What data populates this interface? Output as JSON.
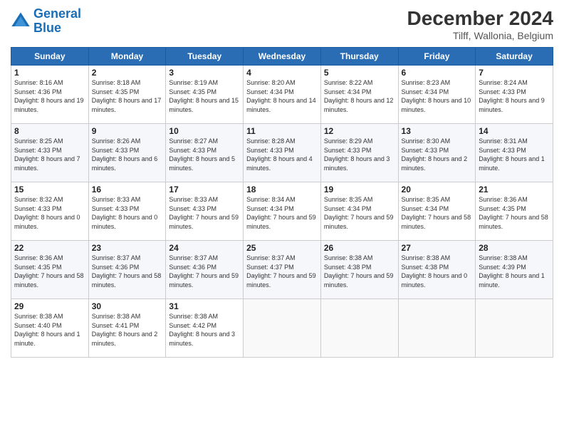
{
  "logo": {
    "line1": "General",
    "line2": "Blue"
  },
  "title": "December 2024",
  "subtitle": "Tilff, Wallonia, Belgium",
  "weekdays": [
    "Sunday",
    "Monday",
    "Tuesday",
    "Wednesday",
    "Thursday",
    "Friday",
    "Saturday"
  ],
  "weeks": [
    [
      {
        "day": "1",
        "sunrise": "8:16 AM",
        "sunset": "4:36 PM",
        "daylight": "8 hours and 19 minutes."
      },
      {
        "day": "2",
        "sunrise": "8:18 AM",
        "sunset": "4:35 PM",
        "daylight": "8 hours and 17 minutes."
      },
      {
        "day": "3",
        "sunrise": "8:19 AM",
        "sunset": "4:35 PM",
        "daylight": "8 hours and 15 minutes."
      },
      {
        "day": "4",
        "sunrise": "8:20 AM",
        "sunset": "4:34 PM",
        "daylight": "8 hours and 14 minutes."
      },
      {
        "day": "5",
        "sunrise": "8:22 AM",
        "sunset": "4:34 PM",
        "daylight": "8 hours and 12 minutes."
      },
      {
        "day": "6",
        "sunrise": "8:23 AM",
        "sunset": "4:34 PM",
        "daylight": "8 hours and 10 minutes."
      },
      {
        "day": "7",
        "sunrise": "8:24 AM",
        "sunset": "4:33 PM",
        "daylight": "8 hours and 9 minutes."
      }
    ],
    [
      {
        "day": "8",
        "sunrise": "8:25 AM",
        "sunset": "4:33 PM",
        "daylight": "8 hours and 7 minutes."
      },
      {
        "day": "9",
        "sunrise": "8:26 AM",
        "sunset": "4:33 PM",
        "daylight": "8 hours and 6 minutes."
      },
      {
        "day": "10",
        "sunrise": "8:27 AM",
        "sunset": "4:33 PM",
        "daylight": "8 hours and 5 minutes."
      },
      {
        "day": "11",
        "sunrise": "8:28 AM",
        "sunset": "4:33 PM",
        "daylight": "8 hours and 4 minutes."
      },
      {
        "day": "12",
        "sunrise": "8:29 AM",
        "sunset": "4:33 PM",
        "daylight": "8 hours and 3 minutes."
      },
      {
        "day": "13",
        "sunrise": "8:30 AM",
        "sunset": "4:33 PM",
        "daylight": "8 hours and 2 minutes."
      },
      {
        "day": "14",
        "sunrise": "8:31 AM",
        "sunset": "4:33 PM",
        "daylight": "8 hours and 1 minute."
      }
    ],
    [
      {
        "day": "15",
        "sunrise": "8:32 AM",
        "sunset": "4:33 PM",
        "daylight": "8 hours and 0 minutes."
      },
      {
        "day": "16",
        "sunrise": "8:33 AM",
        "sunset": "4:33 PM",
        "daylight": "8 hours and 0 minutes."
      },
      {
        "day": "17",
        "sunrise": "8:33 AM",
        "sunset": "4:33 PM",
        "daylight": "7 hours and 59 minutes."
      },
      {
        "day": "18",
        "sunrise": "8:34 AM",
        "sunset": "4:34 PM",
        "daylight": "7 hours and 59 minutes."
      },
      {
        "day": "19",
        "sunrise": "8:35 AM",
        "sunset": "4:34 PM",
        "daylight": "7 hours and 59 minutes."
      },
      {
        "day": "20",
        "sunrise": "8:35 AM",
        "sunset": "4:34 PM",
        "daylight": "7 hours and 58 minutes."
      },
      {
        "day": "21",
        "sunrise": "8:36 AM",
        "sunset": "4:35 PM",
        "daylight": "7 hours and 58 minutes."
      }
    ],
    [
      {
        "day": "22",
        "sunrise": "8:36 AM",
        "sunset": "4:35 PM",
        "daylight": "7 hours and 58 minutes."
      },
      {
        "day": "23",
        "sunrise": "8:37 AM",
        "sunset": "4:36 PM",
        "daylight": "7 hours and 58 minutes."
      },
      {
        "day": "24",
        "sunrise": "8:37 AM",
        "sunset": "4:36 PM",
        "daylight": "7 hours and 59 minutes."
      },
      {
        "day": "25",
        "sunrise": "8:37 AM",
        "sunset": "4:37 PM",
        "daylight": "7 hours and 59 minutes."
      },
      {
        "day": "26",
        "sunrise": "8:38 AM",
        "sunset": "4:38 PM",
        "daylight": "7 hours and 59 minutes."
      },
      {
        "day": "27",
        "sunrise": "8:38 AM",
        "sunset": "4:38 PM",
        "daylight": "8 hours and 0 minutes."
      },
      {
        "day": "28",
        "sunrise": "8:38 AM",
        "sunset": "4:39 PM",
        "daylight": "8 hours and 1 minute."
      }
    ],
    [
      {
        "day": "29",
        "sunrise": "8:38 AM",
        "sunset": "4:40 PM",
        "daylight": "8 hours and 1 minute."
      },
      {
        "day": "30",
        "sunrise": "8:38 AM",
        "sunset": "4:41 PM",
        "daylight": "8 hours and 2 minutes."
      },
      {
        "day": "31",
        "sunrise": "8:38 AM",
        "sunset": "4:42 PM",
        "daylight": "8 hours and 3 minutes."
      },
      null,
      null,
      null,
      null
    ]
  ],
  "labels": {
    "sunrise": "Sunrise:",
    "sunset": "Sunset:",
    "daylight": "Daylight:"
  }
}
